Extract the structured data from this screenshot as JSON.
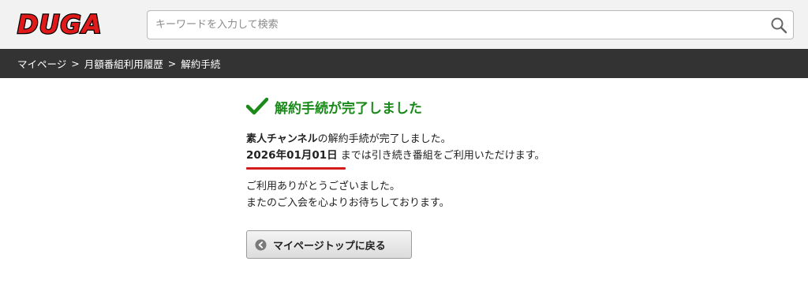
{
  "header": {
    "logo_text": "DUGA",
    "search": {
      "placeholder": "キーワードを入力して検索",
      "value": ""
    }
  },
  "breadcrumb": [
    "マイページ",
    "月額番組利用履歴",
    "解約手続"
  ],
  "breadcrumb_separator": ">",
  "main": {
    "title": "解約手続が完了しました",
    "channel_name": "素人チャンネル",
    "completed_suffix": "の解約手続が完了しました。",
    "end_date": "2026年01月01日",
    "continue_text": "までは引き続き番組をご利用いただけます。",
    "thanks_line1": "ご利用ありがとうございました。",
    "thanks_line2": "またのご入会を心よりお待ちしております。",
    "back_button": "マイページトップに戻る"
  },
  "colors": {
    "accent_green": "#1a8a1a",
    "underline_red": "#d41b1b",
    "breadcrumb_bg": "#333333",
    "logo_red": "#e01a1a"
  }
}
